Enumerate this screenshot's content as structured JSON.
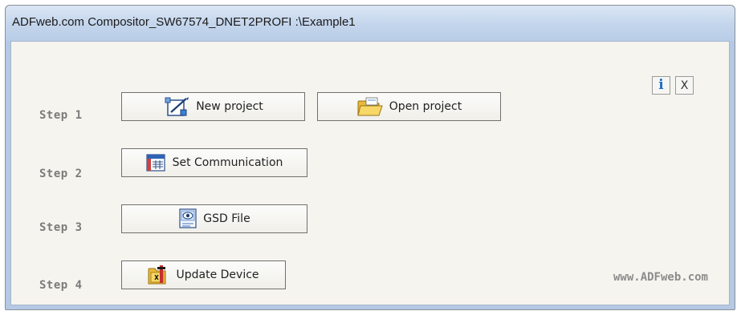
{
  "window": {
    "title": "ADFweb.com Compositor_SW67574_DNET2PROFI :\\Example1"
  },
  "steps": [
    {
      "label": "Step 1"
    },
    {
      "label": "Step 2"
    },
    {
      "label": "Step 3"
    },
    {
      "label": "Step 4"
    }
  ],
  "buttons": {
    "new_project": {
      "label": "New project",
      "icon": "new-project-icon"
    },
    "open_project": {
      "label": "Open project",
      "icon": "folder-icon"
    },
    "set_communication": {
      "label": "Set Communication",
      "icon": "communication-icon"
    },
    "gsd_file": {
      "label": "GSD File",
      "icon": "gsd-file-icon"
    },
    "update_device": {
      "label": "Update Device",
      "icon": "update-device-icon"
    },
    "info": {
      "glyph": "i",
      "icon": "info-icon"
    },
    "close": {
      "glyph": "X",
      "icon": "close-icon"
    }
  },
  "footer": {
    "brand": "www.ADFweb.com"
  },
  "colors": {
    "titlebar": "#c3d5ec",
    "client_bg": "#f5f4ee",
    "step_text": "#7b7b7b",
    "info_blue": "#1e6fc5"
  }
}
